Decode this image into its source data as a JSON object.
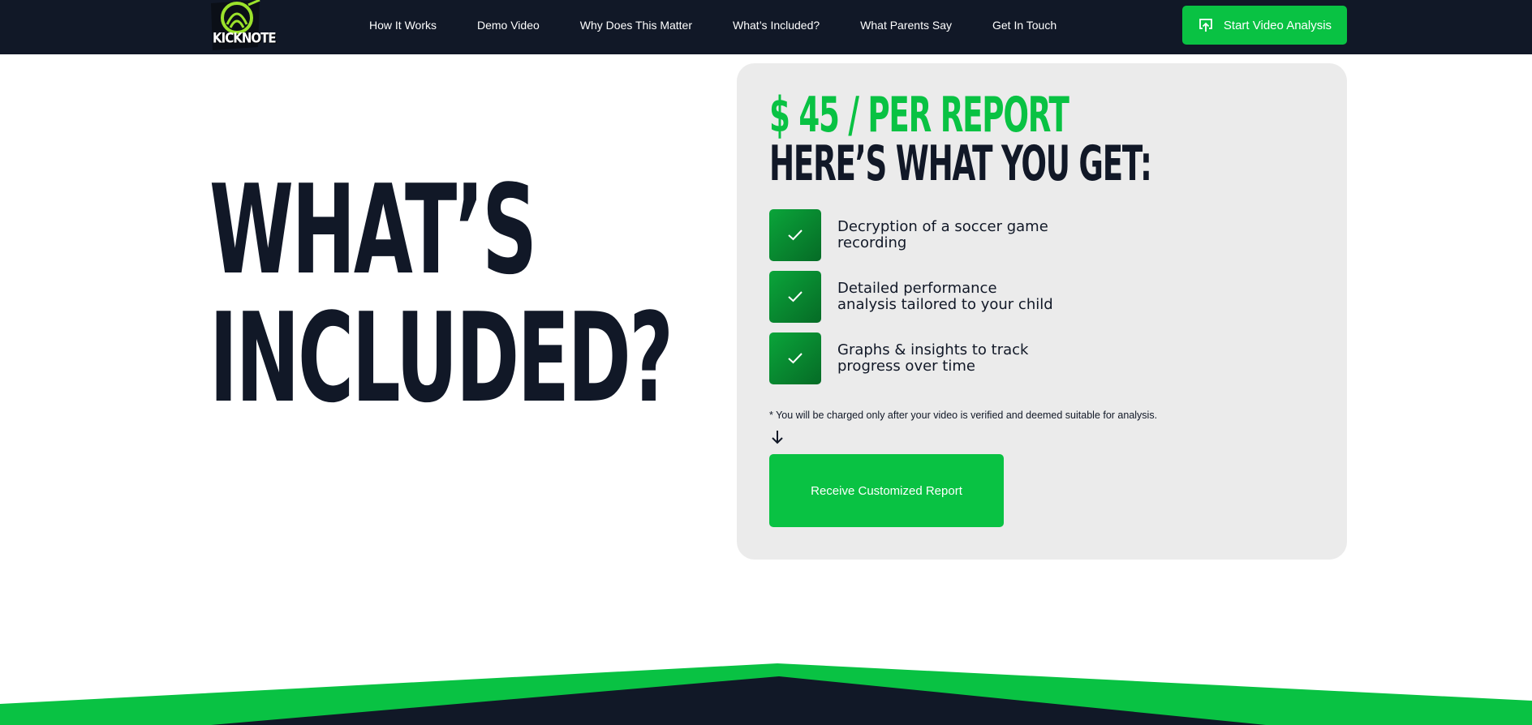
{
  "nav": {
    "brand": "KICKNOTE",
    "links": [
      {
        "label": "How It Works"
      },
      {
        "label": "Demo Video"
      },
      {
        "label": "Why Does This Matter"
      },
      {
        "label": "What’s Included?"
      },
      {
        "label": "What Parents Say"
      },
      {
        "label": "Get In Touch"
      }
    ],
    "cta_label": "Start Video Analysis",
    "cta_icon": "upload-icon"
  },
  "hero": {
    "title_line1": "WHAT’S",
    "title_line2": "INCLUDED?"
  },
  "card": {
    "price": "$ 45 / PER REPORT",
    "subhead": "HERE’S WHAT YOU GET:",
    "features": [
      {
        "text": "Decryption of a soccer game recording",
        "icon": "check-icon"
      },
      {
        "text": "Detailed performance analysis tailored to your child",
        "icon": "check-icon"
      },
      {
        "text": "Graphs & insights to track progress over time",
        "icon": "check-icon"
      }
    ],
    "note": "* You will be charged only after your video is verified and deemed suitable for analysis.",
    "button_label": "Receive Customized Report"
  },
  "colors": {
    "navy": "#111827",
    "green": "#09c243",
    "dark_green": "#066b26",
    "card_bg": "#ebebeb"
  }
}
